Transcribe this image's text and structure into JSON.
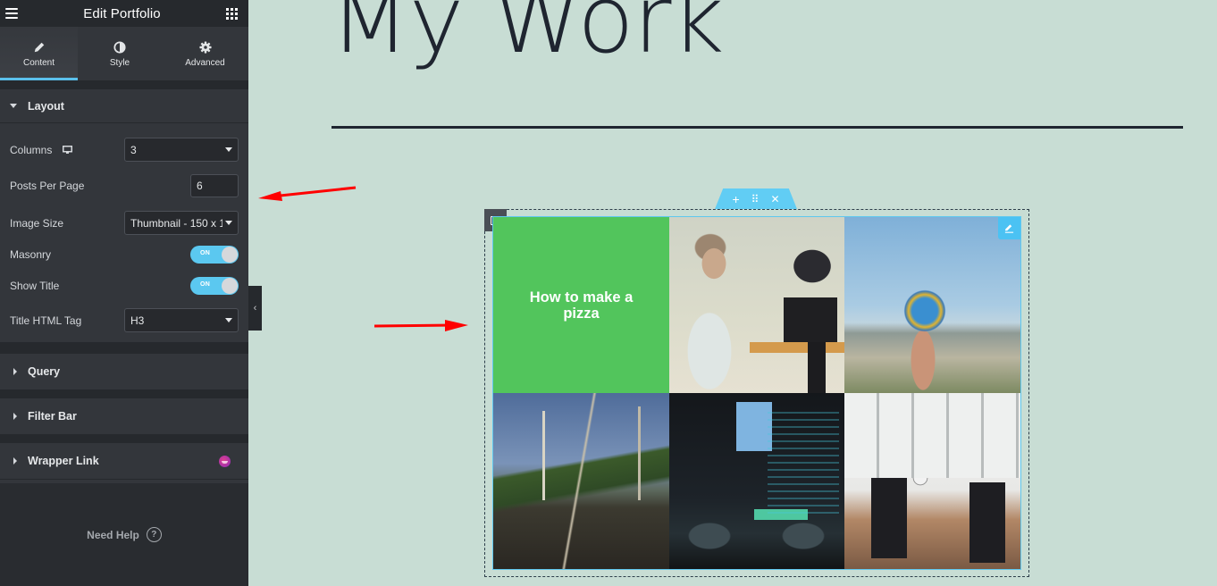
{
  "panel": {
    "title": "Edit Portfolio",
    "tabs": [
      {
        "label": "Content",
        "icon": "pencil-icon",
        "active": true
      },
      {
        "label": "Style",
        "icon": "half-circle-icon",
        "active": false
      },
      {
        "label": "Advanced",
        "icon": "gear-icon",
        "active": false
      }
    ],
    "layout_section": {
      "title": "Layout",
      "columns": {
        "label": "Columns",
        "value": "3",
        "device_icon": "desktop-icon"
      },
      "posts_per_page": {
        "label": "Posts Per Page",
        "value": "6"
      },
      "image_size": {
        "label": "Image Size",
        "value": "Thumbnail - 150 x 1"
      },
      "masonry": {
        "label": "Masonry",
        "state": "ON"
      },
      "show_title": {
        "label": "Show Title",
        "state": "ON"
      },
      "title_html_tag": {
        "label": "Title HTML Tag",
        "value": "H3"
      }
    },
    "collapsed_sections": [
      {
        "title": "Query"
      },
      {
        "title": "Filter Bar"
      },
      {
        "title": "Wrapper Link",
        "badge_icon": "pro-feature-icon"
      }
    ],
    "help": {
      "label": "Need Help",
      "icon": "?"
    }
  },
  "canvas": {
    "heading": "My Work",
    "widget_toolbar": {
      "add": "+",
      "move": "⠿",
      "close": "✕"
    },
    "portfolio": {
      "items": [
        {
          "type": "title",
          "title": "How to make a pizza"
        },
        {
          "type": "image",
          "subject": "woman-vlogging-with-camera"
        },
        {
          "type": "image",
          "subject": "hand-holding-globe"
        },
        {
          "type": "image",
          "subject": "road-with-power-lines"
        },
        {
          "type": "image",
          "subject": "code-screen-with-glasses"
        },
        {
          "type": "image",
          "subject": "two-people-sitting-in-chairs"
        }
      ]
    }
  },
  "annotations": {
    "arrow_color": "#ff0000"
  },
  "colors": {
    "accent": "#5bc0eb",
    "panel_bg": "#33363b",
    "canvas_bg": "#c8ddd4",
    "title_card": "#52c55c",
    "heading": "#1f2530"
  }
}
